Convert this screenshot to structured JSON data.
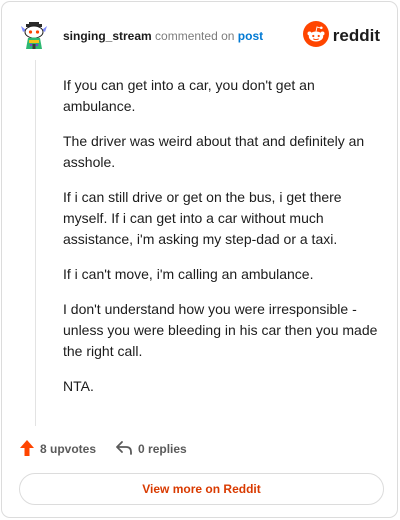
{
  "header": {
    "username": "singing_stream",
    "action_text": "commented on",
    "post_link": "post",
    "brand": "reddit"
  },
  "comment": {
    "paragraphs": [
      "If you can get into a car, you don't get an ambulance.",
      "The driver was weird about that and definitely an asshole.",
      "If i can still drive or get on the bus, i get there myself. If i can get into a car without much assistance, i'm asking my step-dad or a taxi.",
      "If i can't move, i'm calling an ambulance.",
      "I don't understand how you were irresponsible - unless you were bleeding in his car then you made the right call.",
      "NTA."
    ]
  },
  "actions": {
    "upvotes": "8 upvotes",
    "replies": "0 replies"
  },
  "footer": {
    "view_more": "View more on Reddit"
  },
  "colors": {
    "brand_orange": "#ff4500",
    "link_blue": "#0079d3",
    "cta_orange": "#d93a00",
    "border": "#dcdcdc"
  },
  "icons": {
    "avatar": "snoo-avatar-icon",
    "logo": "reddit-snoo-icon",
    "upvote": "upvote-arrow-icon",
    "reply": "reply-arrow-icon"
  }
}
